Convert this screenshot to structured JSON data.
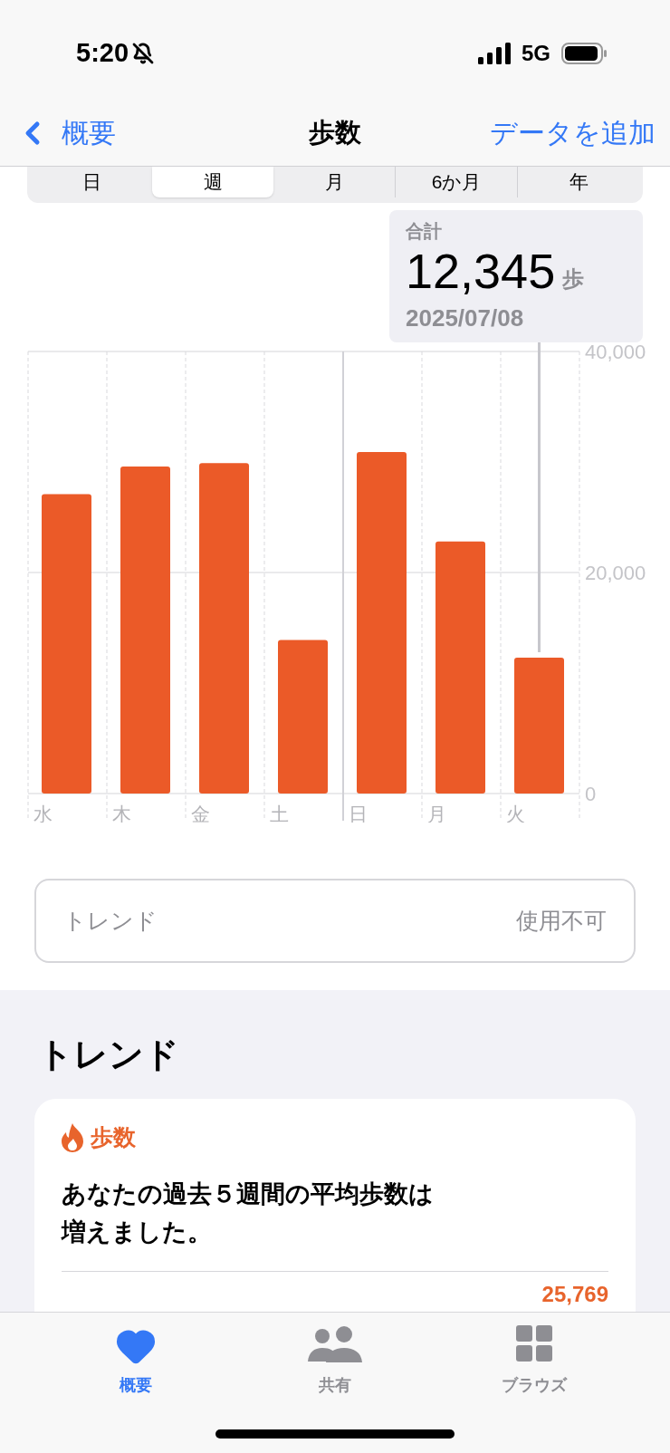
{
  "status_bar": {
    "time": "5:20",
    "network": "5G"
  },
  "nav": {
    "back": "概要",
    "title": "歩数",
    "action": "データを追加"
  },
  "segments": [
    {
      "label": "日",
      "selected": false
    },
    {
      "label": "週",
      "selected": true
    },
    {
      "label": "月",
      "selected": false
    },
    {
      "label": "6か月",
      "selected": false
    },
    {
      "label": "年",
      "selected": false
    }
  ],
  "summary": {
    "label": "合計",
    "value": "12,345",
    "unit": "歩",
    "date": "2025/07/08"
  },
  "chart": {
    "chart_data": {
      "type": "bar",
      "categories": [
        "水",
        "木",
        "金",
        "土",
        "日",
        "月",
        "火"
      ],
      "series": [
        {
          "color": "#eb5a28",
          "values": [
            27100,
            29600,
            29900,
            13900,
            30900,
            22800,
            12300
          ]
        }
      ],
      "ylim": [
        0,
        40000
      ],
      "yticks": [
        {
          "value": 0,
          "label": "0"
        },
        {
          "value": 20000,
          "label": "20,000"
        },
        {
          "value": 40000,
          "label": "40,000"
        }
      ]
    }
  },
  "trend_row": {
    "label": "トレンド",
    "value": "使用不可"
  },
  "trends": {
    "heading": "トレンド",
    "card": {
      "title": "歩数",
      "text": "あなたの過去５週間の平均歩数は増えました。",
      "value": "25,769"
    }
  },
  "tab_bar": [
    {
      "label": "概要",
      "selected": true
    },
    {
      "label": "共有",
      "selected": false
    },
    {
      "label": "ブラウズ",
      "selected": false
    }
  ]
}
